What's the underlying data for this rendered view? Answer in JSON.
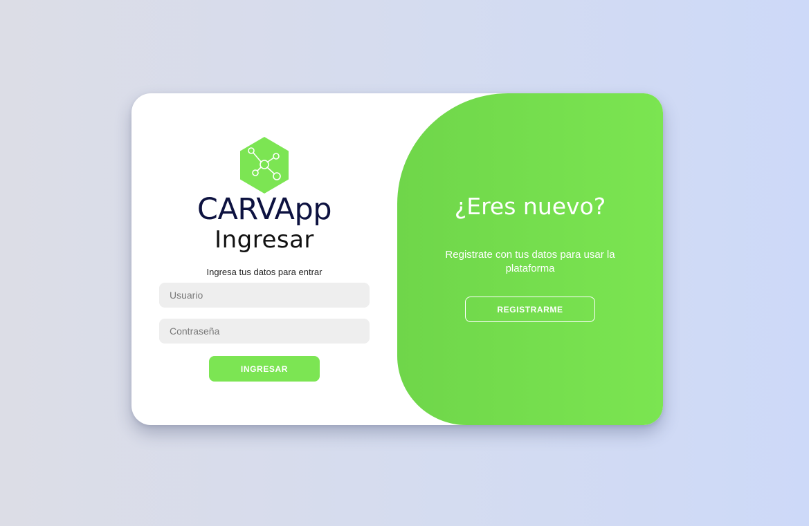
{
  "colors": {
    "accent": "#7ce553",
    "brand_text": "#0d1240",
    "input_bg": "#eeeeee"
  },
  "login": {
    "logo_icon": "network-hexagon-icon",
    "brand_name": "CARVApp",
    "title": "Ingresar",
    "subtitle": "Ingresa tus datos para entrar",
    "username_placeholder": "Usuario",
    "password_placeholder": "Contraseña",
    "submit_label": "INGRESAR"
  },
  "register": {
    "title": "¿Eres nuevo?",
    "description": "Registrate con tus datos para usar la plataforma",
    "button_label": "REGISTRARME"
  }
}
